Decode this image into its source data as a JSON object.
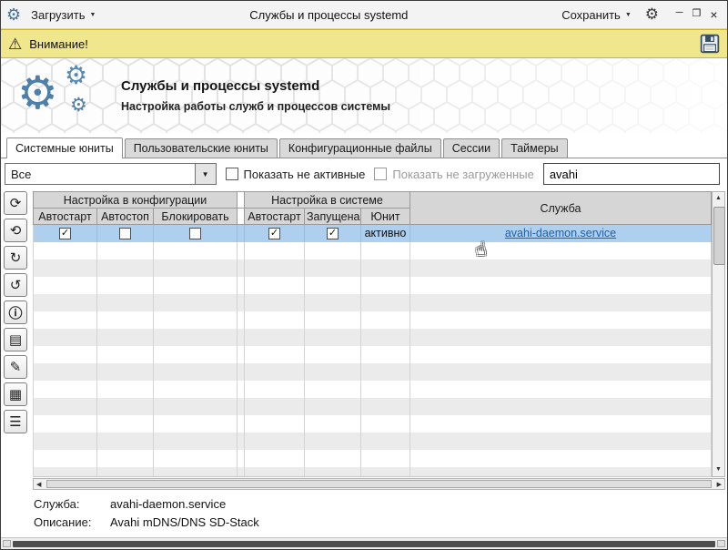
{
  "icons": {
    "gear": "⚙",
    "warning": "⚠",
    "caret_down": "▼",
    "arrow_up": "▲",
    "arrow_down": "▼",
    "arrow_left": "◀",
    "arrow_right": "▶",
    "hand": "☝",
    "minimize": "─",
    "maximize": "❐",
    "close": "×",
    "refresh": "⟳",
    "restart": "⟲",
    "start": "↻",
    "stop": "↺",
    "info": "ⓘ",
    "unit_file": "▤",
    "edit": "✎",
    "journal": "▦",
    "list": "☰"
  },
  "colors": {
    "accent_blue": "#4d7fa9",
    "selection": "#aed0ee",
    "link": "#1e5fae",
    "warning_bg": "#f0e68c"
  },
  "titlebar": {
    "load_label": "Загрузить",
    "title": "Службы и процессы systemd",
    "save_label": "Сохранить"
  },
  "warning_bar": {
    "text": "Внимание!"
  },
  "header": {
    "title": "Службы и процессы systemd",
    "subtitle": "Настройка работы служб и процессов системы"
  },
  "tabs": [
    {
      "label": "Системные юниты",
      "active": true
    },
    {
      "label": "Пользовательские юниты",
      "active": false
    },
    {
      "label": "Конфигурационные файлы",
      "active": false
    },
    {
      "label": "Сессии",
      "active": false
    },
    {
      "label": "Таймеры",
      "active": false
    }
  ],
  "filterbar": {
    "filter_value": "Все",
    "show_inactive_label": "Показать не активные",
    "show_unloaded_label": "Показать не загруженные",
    "search_value": "avahi"
  },
  "table": {
    "group_config": "Настройка в конфигурации",
    "group_system": "Настройка в системе",
    "service_header": "Служба",
    "columns": [
      "Автостарт",
      "Автостоп",
      "Блокировать",
      "Автостарт",
      "Запущена",
      "Юнит"
    ],
    "rows": [
      {
        "cfg_autostart": "✓",
        "cfg_autostop": "",
        "cfg_block": "",
        "sys_autostart": "✓",
        "sys_running": "✓",
        "unit_state": "активно",
        "service": "avahi-daemon.service"
      }
    ]
  },
  "details": {
    "service_label": "Служба:",
    "service_value": "avahi-daemon.service",
    "description_label": "Описание:",
    "description_value": "Avahi mDNS/DNS SD-Stack"
  }
}
